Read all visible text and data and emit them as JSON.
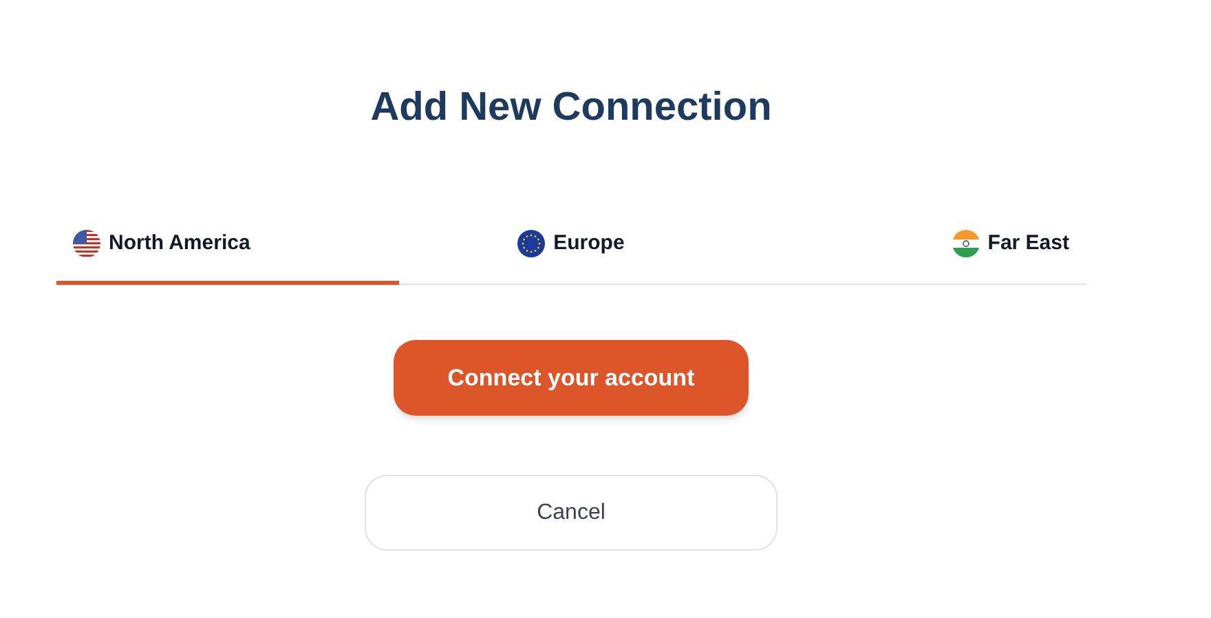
{
  "title": "Add New Connection",
  "tabs": [
    {
      "label": "North America",
      "kind": "us",
      "selected": true
    },
    {
      "label": "Europe",
      "kind": "eu",
      "selected": false
    },
    {
      "label": "Far East",
      "kind": "in",
      "selected": false
    }
  ],
  "primary_button": "Connect your account",
  "cancel_button": "Cancel"
}
